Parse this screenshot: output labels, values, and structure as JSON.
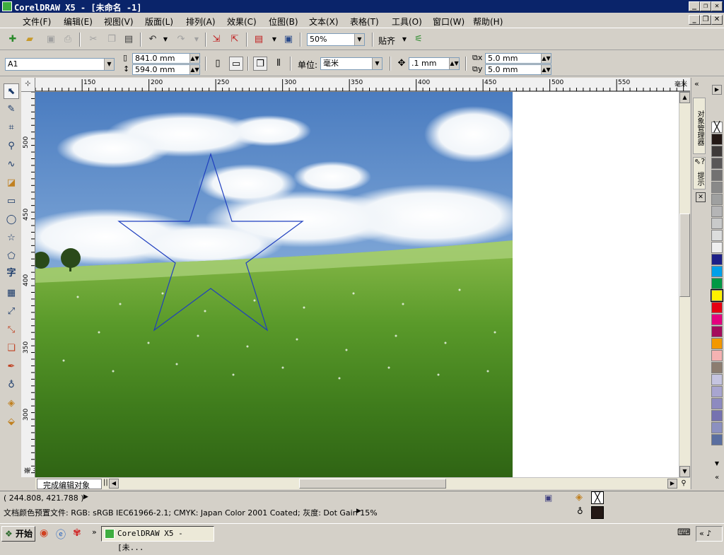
{
  "window": {
    "title": "CorelDRAW X5 - [未命名 -1]"
  },
  "menu": [
    "文件(F)",
    "编辑(E)",
    "视图(V)",
    "版面(L)",
    "排列(A)",
    "效果(C)",
    "位图(B)",
    "文本(X)",
    "表格(T)",
    "工具(O)",
    "窗口(W)",
    "帮助(H)"
  ],
  "toolbar": {
    "zoom": "50%",
    "snap_label": "贴齐"
  },
  "property_bar": {
    "page_size": "A1",
    "width": "841.0 mm",
    "height": "594.0 mm",
    "unit_label": "单位:",
    "unit": "毫米",
    "nudge": ".1 mm",
    "dup_x": "5.0 mm",
    "dup_y": "5.0 mm"
  },
  "rulers": {
    "h_labels": [
      "150",
      "200",
      "250",
      "300",
      "350",
      "400",
      "450",
      "500",
      "550"
    ],
    "h_unit": "毫米",
    "v_labels": [
      "500",
      "450",
      "400",
      "350",
      "300"
    ],
    "v_unit": "毫米"
  },
  "dockers": {
    "object_manager": "对象管理器",
    "hints": "提示"
  },
  "page_tab": "完成编辑对象",
  "status": {
    "coords": "( 244.808, 421.788 )",
    "profile": "文档颜色预置文件: RGB: sRGB IEC61966-2.1; CMYK: Japan Color 2001 Coated; 灰度: Dot Gain 15%"
  },
  "palette_colors": [
    "#ffffff",
    "#231815",
    "#3e3a39",
    "#595757",
    "#727171",
    "#898989",
    "#9fa0a0",
    "#b5b5b6",
    "#c9caca",
    "#dcdddd",
    "#efefef",
    "#1d2088",
    "#00a0e9",
    "#009944",
    "#fff100",
    "#e60012",
    "#e4007f",
    "#a40b5d",
    "#f39800",
    "#f5b2b2",
    "#8c7d70",
    "#c5c4e0",
    "#a8a5d0",
    "#8d8ac0",
    "#7672b0",
    "#8c90c0",
    "#5a6ea0"
  ],
  "taskbar": {
    "start": "开始",
    "task": "CorelDRAW X5 - [未..."
  },
  "icons": [
    "app-icon",
    "new-icon",
    "open-icon",
    "save-icon",
    "print-icon",
    "cut-icon",
    "copy-icon",
    "paste-icon",
    "undo-icon",
    "redo-icon",
    "import-icon",
    "export-icon",
    "app-launcher-icon",
    "welcome-icon",
    "pick-tool-icon",
    "shape-tool-icon",
    "crop-tool-icon",
    "zoom-tool-icon",
    "freehand-tool-icon",
    "smart-fill-icon",
    "rectangle-tool-icon",
    "ellipse-tool-icon",
    "polygon-tool-icon",
    "basic-shapes-icon",
    "text-tool-icon",
    "table-tool-icon",
    "dimension-tool-icon",
    "connector-tool-icon",
    "blend-tool-icon",
    "eyedropper-tool-icon",
    "outline-tool-icon",
    "fill-tool-icon",
    "interactive-fill-icon"
  ]
}
